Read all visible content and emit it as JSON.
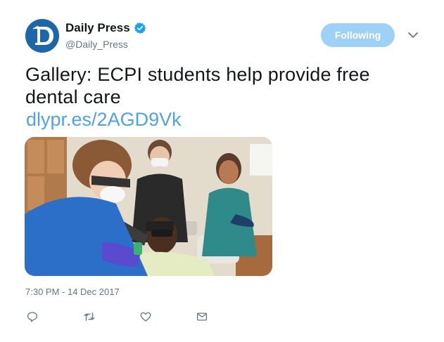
{
  "author": {
    "display_name": "Daily Press",
    "handle": "@Daily_Press",
    "verified": true,
    "avatar_icon": "daily-press-logo-icon"
  },
  "follow_button": {
    "label": "Following"
  },
  "tweet": {
    "text_line_1": "Gallery: ECPI students help provide free",
    "text_line_2": "dental care",
    "link": "dlypr.es/2AGD9Vk",
    "timestamp": "7:30 PM - 14 Dec 2017"
  },
  "actions": [
    {
      "name": "reply-icon"
    },
    {
      "name": "retweet-icon"
    },
    {
      "name": "like-icon"
    },
    {
      "name": "direct-message-icon"
    }
  ],
  "colors": {
    "link": "#4fa3e3",
    "follow_button_bg": "#9fd0f5",
    "secondary_text": "#657786",
    "verified_badge": "#1da1f2"
  }
}
